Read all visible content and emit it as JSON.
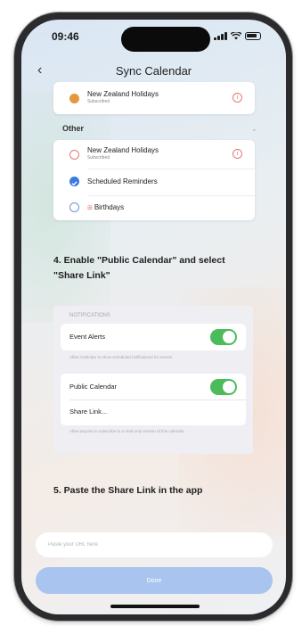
{
  "status": {
    "time": "09:46"
  },
  "nav": {
    "title": "Sync Calendar"
  },
  "top_calendar": {
    "name": "New Zealand Holidays",
    "sub": "Subscribed",
    "color": "#e5973a"
  },
  "other_section": {
    "label": "Other",
    "items": [
      {
        "name": "New Zealand Holidays",
        "sub": "Subscribed",
        "color": "#e27a77",
        "filled": false,
        "info": true
      },
      {
        "name": "Scheduled Reminders",
        "sub": "",
        "color": "#3b7be0",
        "filled": true,
        "info": false
      },
      {
        "name": "Birthdays",
        "sub": "",
        "color": "#6a92d8",
        "filled": false,
        "info": false
      }
    ]
  },
  "step4": {
    "heading_line1": "4. Enable \"Public Calendar\" and select",
    "heading_line2": "\"Share Link\""
  },
  "settings": {
    "header": "NOTIFICATIONS",
    "event_alerts": "Event Alerts",
    "event_note": "Allow Calendar to show scheduled notifications for events.",
    "public_calendar": "Public Calendar",
    "share_link": "Share Link...",
    "public_note": "Allow anyone to subscribe to a read-only version of this calendar.",
    "accent": "#4cbb5a"
  },
  "step5": {
    "heading": "5. Paste the Share Link in the app"
  },
  "input": {
    "placeholder": "Paste your URL here"
  },
  "submit": {
    "label": "Done",
    "color": "#a9c4ef"
  },
  "birthday_icon": "gift-icon"
}
